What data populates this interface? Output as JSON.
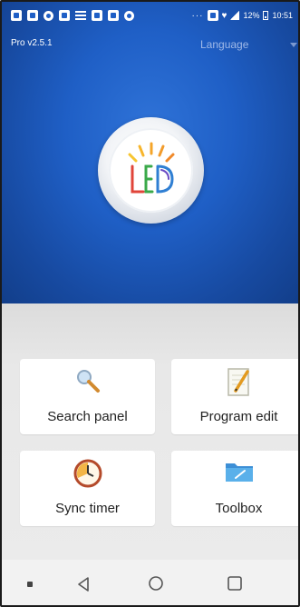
{
  "status_bar": {
    "dots": "···",
    "battery_percent": "12%",
    "time": "10:51"
  },
  "header": {
    "version": "Pro v2.5.1",
    "language_label": "Language"
  },
  "logo": {
    "text": "LED"
  },
  "menu": [
    {
      "label": "Search panel",
      "icon": "magnifier-icon"
    },
    {
      "label": "Program edit",
      "icon": "notepad-pencil-icon"
    },
    {
      "label": "Sync timer",
      "icon": "clock-icon"
    },
    {
      "label": "Toolbox",
      "icon": "folder-icon"
    }
  ],
  "colors": {
    "hero_blue": "#1f5fc6",
    "panel_gray": "#ebebeb",
    "card_white": "#ffffff"
  }
}
